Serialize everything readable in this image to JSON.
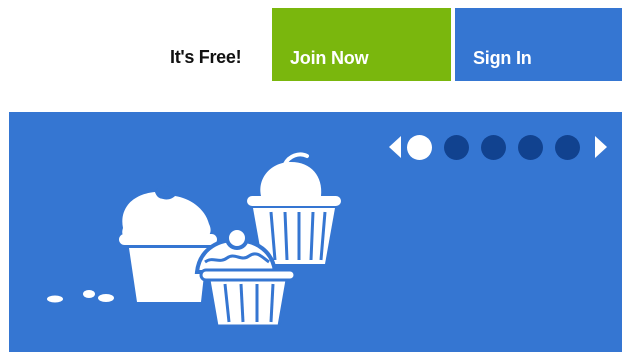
{
  "header": {
    "free_label": "It's Free!",
    "join_label": "Join Now",
    "signin_label": "Sign In"
  },
  "carousel": {
    "active_index": 0,
    "slide_count": 5,
    "prev_icon": "chevron-left-icon",
    "next_icon": "chevron-right-icon"
  },
  "banner": {
    "illustration": "cupcakes-icon"
  },
  "colors": {
    "join_green": "#7ab70d",
    "brand_blue": "#3576d2",
    "dot_inactive": "#11428f",
    "dot_active": "#ffffff"
  }
}
